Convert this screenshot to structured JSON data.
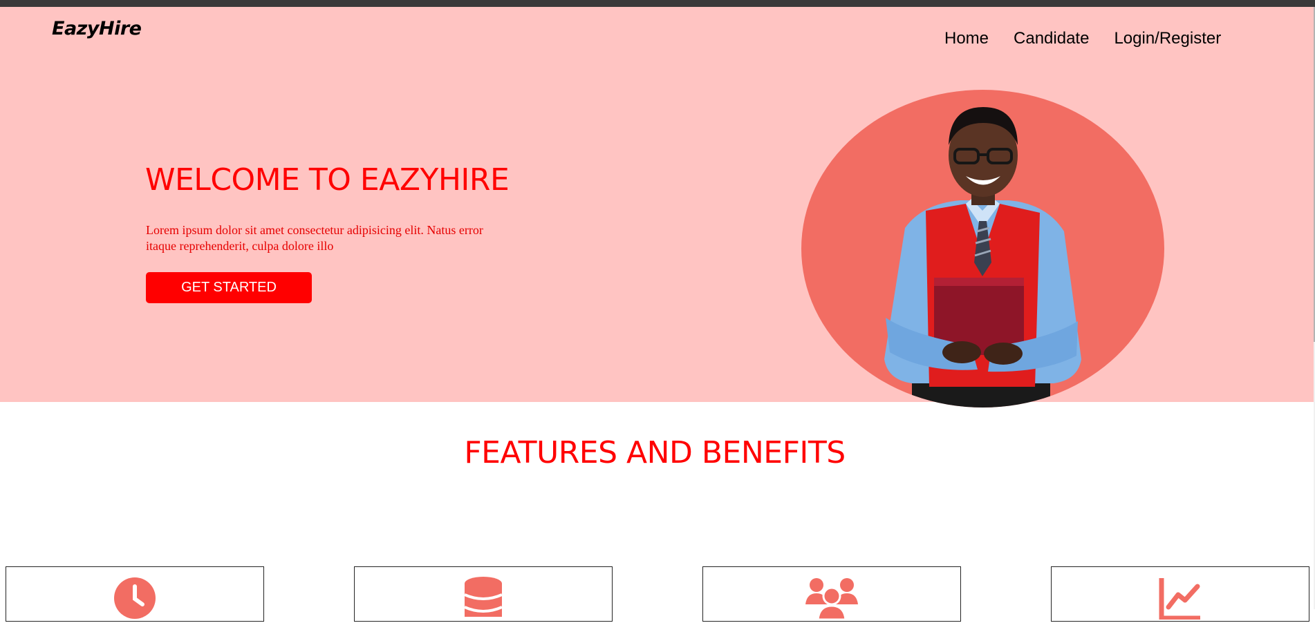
{
  "brand": {
    "logo": "EazyHire"
  },
  "nav": {
    "home": "Home",
    "candidate": "Candidate",
    "login": "Login/Register"
  },
  "hero": {
    "title": "WELCOME TO EAZYHIRE",
    "text": "Lorem ipsum dolor sit amet consectetur adipisicing elit. Natus error itaque reprehenderit, culpa dolore illo",
    "cta": "GET STARTED"
  },
  "features": {
    "title": "FEATURES AND BENEFITS",
    "cards": [
      {
        "icon": "clock-icon"
      },
      {
        "icon": "database-icon"
      },
      {
        "icon": "users-icon"
      },
      {
        "icon": "chart-line-icon"
      }
    ]
  },
  "colors": {
    "hero_bg": "#ffc4c2",
    "accent": "#ff0000",
    "circle": "#f26d63",
    "icon": "#f26d63"
  }
}
